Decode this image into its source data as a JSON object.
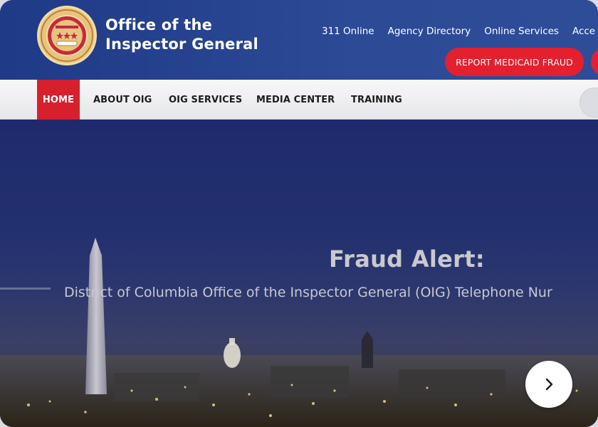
{
  "header": {
    "title_line1": "Office of the",
    "title_line2": "Inspector General",
    "util_links": [
      "311 Online",
      "Agency Directory",
      "Online Services",
      "Acce"
    ],
    "report_button": "REPORT MEDICAID FRAUD"
  },
  "nav": {
    "items": [
      "HOME",
      "ABOUT OIG",
      "OIG SERVICES",
      "MEDIA CENTER",
      "TRAINING"
    ],
    "active": "HOME"
  },
  "hero": {
    "title": "Fraud Alert:",
    "subtitle": "District of Columbia Office of the Inspector General (OIG) Telephone Nur"
  },
  "colors": {
    "header_blue": "#2c4a96",
    "accent_red": "#e4202e",
    "nav_bg": "#efeff1"
  },
  "icons": {
    "seal": "dc-oig-seal-icon",
    "next": "chevron-right-icon"
  }
}
